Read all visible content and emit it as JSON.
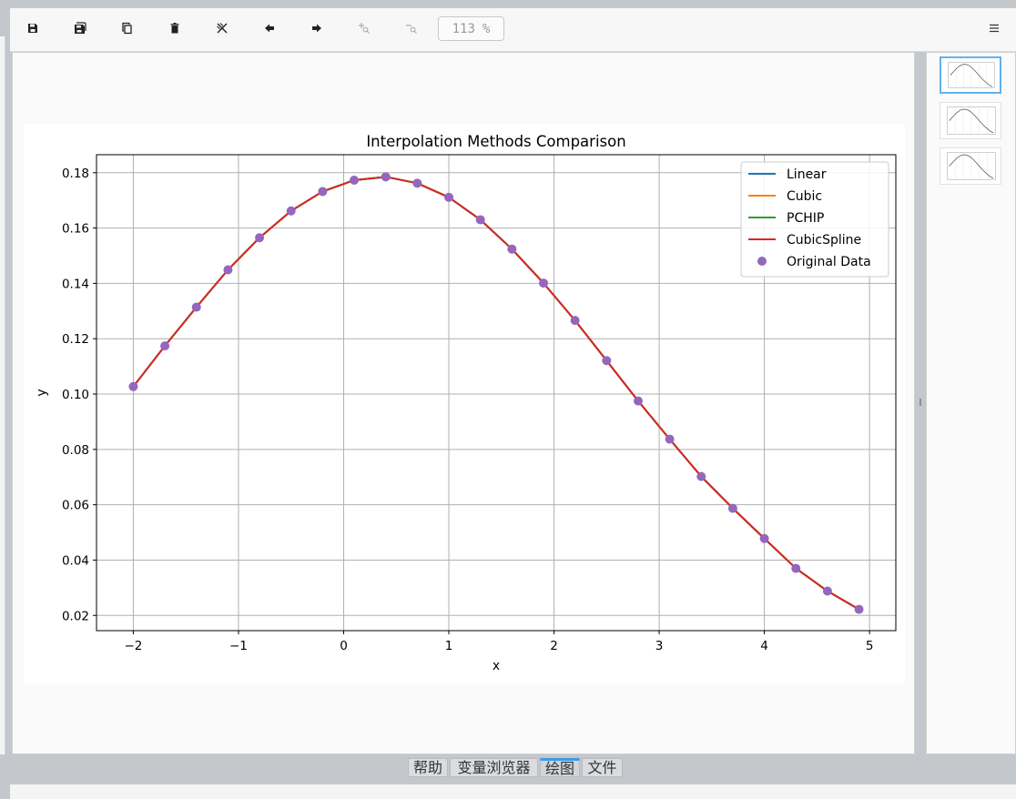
{
  "toolbar": {
    "buttons": [
      {
        "id": "save",
        "icon": "save-icon"
      },
      {
        "id": "save-all",
        "icon": "save-all-icon"
      },
      {
        "id": "copy",
        "icon": "copy-icon"
      },
      {
        "id": "delete",
        "icon": "trash-icon"
      },
      {
        "id": "close-all",
        "icon": "close-all-icon"
      },
      {
        "id": "previous",
        "icon": "arrow-left-icon"
      },
      {
        "id": "next",
        "icon": "arrow-right-icon"
      },
      {
        "id": "zoom-in",
        "icon": "zoom-in-icon"
      },
      {
        "id": "zoom-out",
        "icon": "zoom-out-icon"
      }
    ],
    "zoom_value": "113",
    "zoom_unit": "%",
    "menu_icon": "hamburger-menu-icon"
  },
  "tabs": [
    {
      "label": "帮助",
      "active": false
    },
    {
      "label": "变量浏览器",
      "active": false
    },
    {
      "label": "绘图",
      "active": true
    },
    {
      "label": "文件",
      "active": false
    }
  ],
  "thumbnails": [
    {
      "active": true
    },
    {
      "active": false
    },
    {
      "active": false
    }
  ],
  "chart_data": {
    "type": "line",
    "title": "Interpolation Methods Comparison",
    "xlabel": "x",
    "ylabel": "y",
    "xlim": [
      -2.35,
      5.25
    ],
    "ylim": [
      0.0145,
      0.1865
    ],
    "xticks": [
      -2,
      -1,
      0,
      1,
      2,
      3,
      4,
      5
    ],
    "xtick_labels": [
      "−2",
      "−1",
      "0",
      "1",
      "2",
      "3",
      "4",
      "5"
    ],
    "yticks": [
      0.02,
      0.04,
      0.06,
      0.08,
      0.1,
      0.12,
      0.14,
      0.16,
      0.18
    ],
    "ytick_labels": [
      "0.02",
      "0.04",
      "0.06",
      "0.08",
      "0.10",
      "0.12",
      "0.14",
      "0.16",
      "0.18"
    ],
    "grid": true,
    "legend_position": "top-right",
    "x": [
      -2.0,
      -1.7,
      -1.4,
      -1.1,
      -0.8,
      -0.5,
      -0.2,
      0.1,
      0.4,
      0.7,
      1.0,
      1.3,
      1.6,
      1.9,
      2.2,
      2.5,
      2.8,
      3.1,
      3.4,
      3.7,
      4.0,
      4.3,
      4.6,
      4.9
    ],
    "series": [
      {
        "name": "Linear",
        "style": "line",
        "color": "#1f77b4",
        "values": [
          0.1027,
          0.1174,
          0.1314,
          0.1449,
          0.1565,
          0.1662,
          0.1732,
          0.1773,
          0.1785,
          0.1762,
          0.1711,
          0.163,
          0.1524,
          0.1401,
          0.1266,
          0.1121,
          0.0975,
          0.0837,
          0.0702,
          0.0587,
          0.0478,
          0.037,
          0.0288,
          0.0222
        ]
      },
      {
        "name": "Cubic",
        "style": "line",
        "color": "#ff7f0e",
        "values": [
          0.1027,
          0.1174,
          0.1314,
          0.1449,
          0.1565,
          0.1662,
          0.1732,
          0.1773,
          0.1785,
          0.1762,
          0.1711,
          0.163,
          0.1524,
          0.1401,
          0.1266,
          0.1121,
          0.0975,
          0.0837,
          0.0702,
          0.0587,
          0.0478,
          0.037,
          0.0288,
          0.0222
        ]
      },
      {
        "name": "PCHIP",
        "style": "line",
        "color": "#2ca02c",
        "values": [
          0.1027,
          0.1174,
          0.1314,
          0.1449,
          0.1565,
          0.1662,
          0.1732,
          0.1773,
          0.1785,
          0.1762,
          0.1711,
          0.163,
          0.1524,
          0.1401,
          0.1266,
          0.1121,
          0.0975,
          0.0837,
          0.0702,
          0.0587,
          0.0478,
          0.037,
          0.0288,
          0.0222
        ]
      },
      {
        "name": "CubicSpline",
        "style": "line",
        "color": "#d62728",
        "values": [
          0.1027,
          0.1174,
          0.1314,
          0.1449,
          0.1565,
          0.1662,
          0.1732,
          0.1773,
          0.1785,
          0.1762,
          0.1711,
          0.163,
          0.1524,
          0.1401,
          0.1266,
          0.1121,
          0.0975,
          0.0837,
          0.0702,
          0.0587,
          0.0478,
          0.037,
          0.0288,
          0.0222
        ]
      },
      {
        "name": "Original Data",
        "style": "marker",
        "color": "#9467bd",
        "values": [
          0.1027,
          0.1174,
          0.1314,
          0.1449,
          0.1565,
          0.1662,
          0.1732,
          0.1773,
          0.1785,
          0.1762,
          0.1711,
          0.163,
          0.1524,
          0.1401,
          0.1266,
          0.1121,
          0.0975,
          0.0837,
          0.0702,
          0.0587,
          0.0478,
          0.037,
          0.0288,
          0.0222
        ]
      }
    ]
  }
}
